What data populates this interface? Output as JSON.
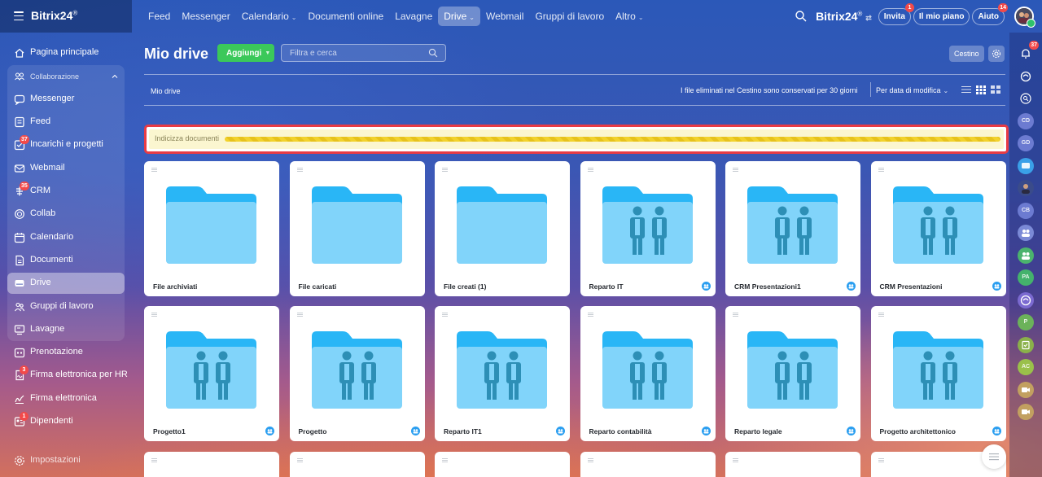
{
  "app": {
    "logo": "Bitrix24",
    "logo_mark": "®",
    "brand_right": "Bitrix24",
    "brand_right_mark": "®"
  },
  "topnav": [
    {
      "label": "Feed",
      "name": "topnav-feed",
      "active": false,
      "dropdown": false
    },
    {
      "label": "Messenger",
      "name": "topnav-messenger",
      "active": false,
      "dropdown": false
    },
    {
      "label": "Calendario",
      "name": "topnav-calendario",
      "active": false,
      "dropdown": true
    },
    {
      "label": "Documenti online",
      "name": "topnav-documenti-online",
      "active": false,
      "dropdown": false
    },
    {
      "label": "Lavagne",
      "name": "topnav-lavagne",
      "active": false,
      "dropdown": false
    },
    {
      "label": "Drive",
      "name": "topnav-drive",
      "active": true,
      "dropdown": true
    },
    {
      "label": "Webmail",
      "name": "topnav-webmail",
      "active": false,
      "dropdown": false
    },
    {
      "label": "Gruppi di lavoro",
      "name": "topnav-gruppi-di-lavoro",
      "active": false,
      "dropdown": false
    },
    {
      "label": "Altro",
      "name": "topnav-altro",
      "active": false,
      "dropdown": true
    }
  ],
  "header_right": {
    "invite": {
      "label": "Invita",
      "badge": "1"
    },
    "plan": {
      "label": "Il mio piano"
    },
    "help": {
      "label": "Aiuto",
      "badge": "14"
    }
  },
  "sidebar": {
    "items": [
      {
        "label": "Pagina principale",
        "icon": "home-icon",
        "badge": "",
        "active": false,
        "sub": false
      },
      {
        "label": "Collaborazione",
        "icon": "collaboration-icon",
        "badge": "",
        "active": false,
        "sub": true
      },
      {
        "label": "Messenger",
        "icon": "chat-icon",
        "badge": "",
        "active": false,
        "sub": false
      },
      {
        "label": "Feed",
        "icon": "feed-icon",
        "badge": "",
        "active": false,
        "sub": false
      },
      {
        "label": "Incarichi e progetti",
        "icon": "tasks-icon",
        "badge": "37",
        "active": false,
        "sub": false
      },
      {
        "label": "Webmail",
        "icon": "mail-icon",
        "badge": "",
        "active": false,
        "sub": false
      },
      {
        "label": "CRM",
        "icon": "crm-icon",
        "badge": "35",
        "active": false,
        "sub": false
      },
      {
        "label": "Collab",
        "icon": "collab-icon",
        "badge": "",
        "active": false,
        "sub": false
      },
      {
        "label": "Calendario",
        "icon": "calendar-icon",
        "badge": "",
        "active": false,
        "sub": false
      },
      {
        "label": "Documenti",
        "icon": "documents-icon",
        "badge": "",
        "active": false,
        "sub": false
      },
      {
        "label": "Drive",
        "icon": "drive-icon",
        "badge": "",
        "active": true,
        "sub": false
      },
      {
        "label": "Gruppi di lavoro",
        "icon": "groups-icon",
        "badge": "",
        "active": false,
        "sub": false
      },
      {
        "label": "Lavagne",
        "icon": "boards-icon",
        "badge": "",
        "active": false,
        "sub": false
      },
      {
        "label": "Prenotazione",
        "icon": "booking-icon",
        "badge": "",
        "active": false,
        "sub": false
      },
      {
        "label": "Firma elettronica per HR",
        "icon": "hr-signature-icon",
        "badge": "3",
        "active": false,
        "sub": false
      },
      {
        "label": "Firma elettronica",
        "icon": "signature-icon",
        "badge": "",
        "active": false,
        "sub": false
      },
      {
        "label": "Dipendenti",
        "icon": "employees-icon",
        "badge": "1",
        "active": false,
        "sub": false
      }
    ],
    "settings_label": "Impostazioni"
  },
  "rail": {
    "notifications_badge": "37",
    "buttons": [
      {
        "name": "rail-notifications-icon",
        "text": ""
      },
      {
        "name": "rail-copilot-icon",
        "text": ""
      },
      {
        "name": "rail-search-chat-icon",
        "text": ""
      },
      {
        "name": "rail-avatar-cd",
        "text": "CD"
      },
      {
        "name": "rail-avatar-gd",
        "text": "GD"
      },
      {
        "name": "rail-chat-icon",
        "text": ""
      },
      {
        "name": "rail-avatar-photo",
        "text": ""
      },
      {
        "name": "rail-avatar-cb",
        "text": "CB"
      },
      {
        "name": "rail-group-icon-1",
        "text": ""
      },
      {
        "name": "rail-group-icon-2",
        "text": ""
      },
      {
        "name": "rail-avatar-pa",
        "text": "PA"
      },
      {
        "name": "rail-copilot-icon-2",
        "text": ""
      },
      {
        "name": "rail-avatar-p",
        "text": "P"
      },
      {
        "name": "rail-tasks-icon",
        "text": ""
      },
      {
        "name": "rail-avatar-ac",
        "text": "AC"
      },
      {
        "name": "rail-video-icon-1",
        "text": ""
      },
      {
        "name": "rail-video-icon-2",
        "text": ""
      }
    ]
  },
  "main": {
    "title": "Mio drive",
    "add_button": "Aggiungi",
    "filter_placeholder": "Filtra e cerca",
    "trash_button": "Cestino",
    "breadcrumb": "Mio drive",
    "retention_note": "I file eliminati nel Cestino sono conservati per 30 giorni",
    "sort_label": "Per data di modifica",
    "indexing_label": "Indicizza documenti",
    "tiles": [
      {
        "label": "File archiviati",
        "shared": false
      },
      {
        "label": "File caricati",
        "shared": false
      },
      {
        "label": "File creati (1)",
        "shared": false
      },
      {
        "label": "Reparto IT",
        "shared": true
      },
      {
        "label": "CRM Presentazioni1",
        "shared": true
      },
      {
        "label": "CRM Presentazioni",
        "shared": true
      },
      {
        "label": "Progetto1",
        "shared": true
      },
      {
        "label": "Progetto",
        "shared": true
      },
      {
        "label": "Reparto IT1",
        "shared": true
      },
      {
        "label": "Reparto contabilità",
        "shared": true
      },
      {
        "label": "Reparto legale",
        "shared": true
      },
      {
        "label": "Progetto architettonico",
        "shared": true
      }
    ],
    "partial_tile_count": 6
  },
  "colors": {
    "accent_green": "#3bc85a",
    "folder_blue": "#29b6f6",
    "folder_light": "#81d4fa",
    "badge_red": "#f24a4a",
    "highlight_red": "#e83b45"
  }
}
